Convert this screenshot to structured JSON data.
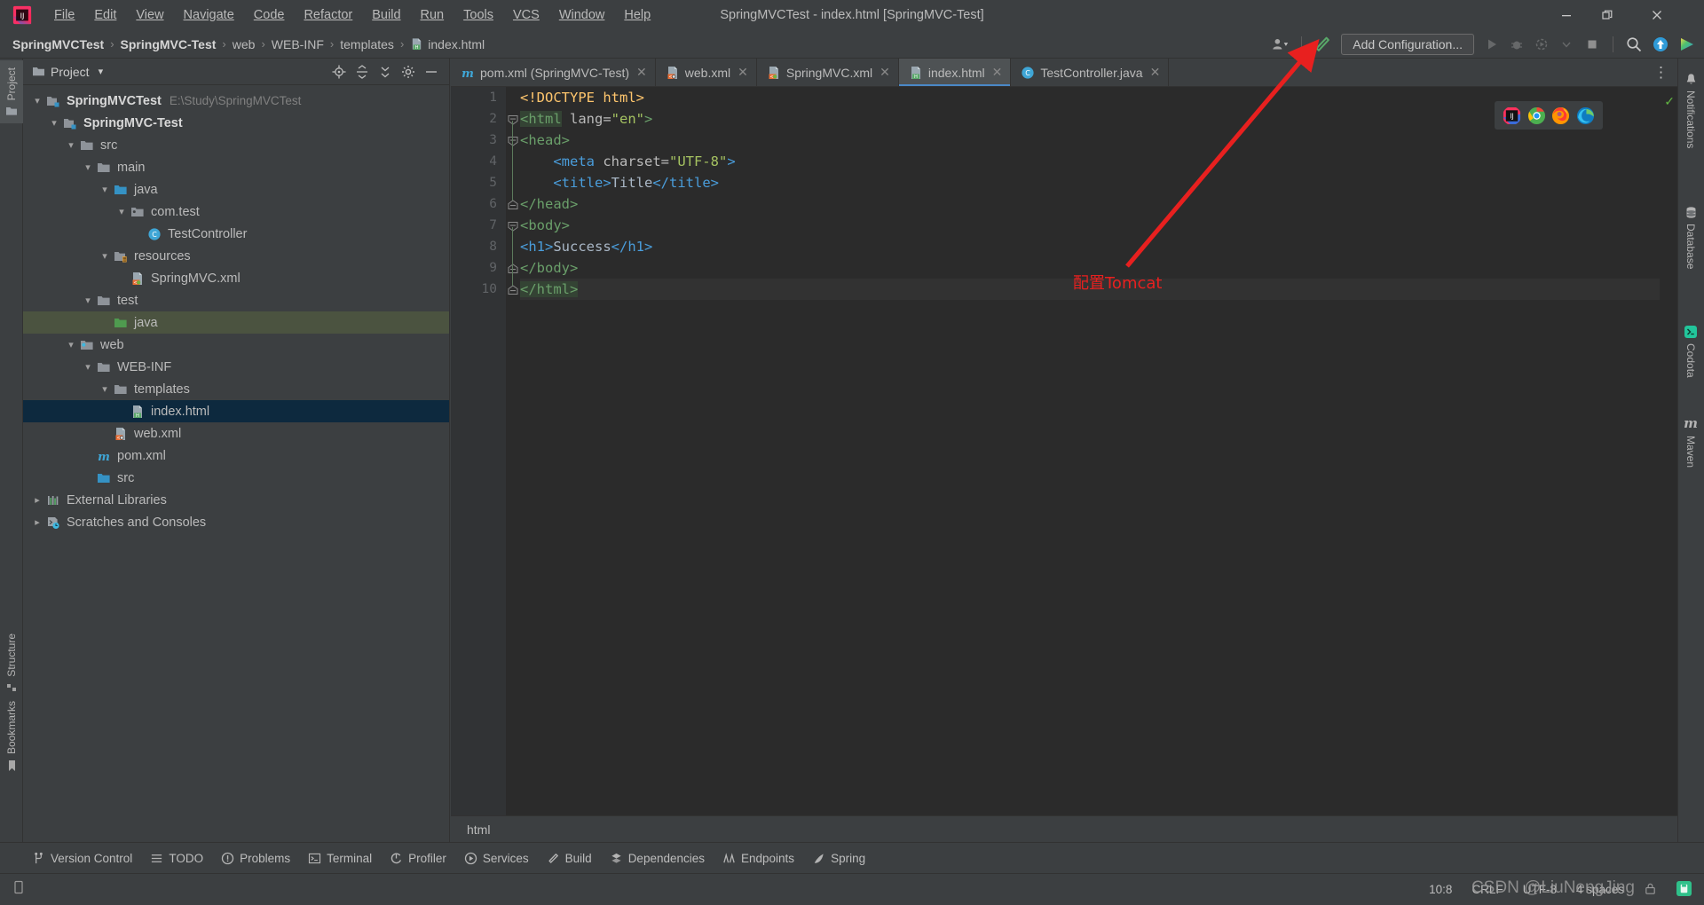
{
  "window": {
    "title": "SpringMVCTest - index.html [SpringMVC-Test]",
    "app_icon": "intellij-idea-logo",
    "minimize": "—",
    "restore": "❐",
    "close": "✕"
  },
  "menu": {
    "items": [
      {
        "label": "File",
        "mnemonic": "F"
      },
      {
        "label": "Edit",
        "mnemonic": "E"
      },
      {
        "label": "View",
        "mnemonic": "V"
      },
      {
        "label": "Navigate",
        "mnemonic": "N"
      },
      {
        "label": "Code",
        "mnemonic": "C"
      },
      {
        "label": "Refactor",
        "mnemonic": "R"
      },
      {
        "label": "Build",
        "mnemonic": "B"
      },
      {
        "label": "Run",
        "mnemonic": "R"
      },
      {
        "label": "Tools",
        "mnemonic": "T"
      },
      {
        "label": "VCS",
        "mnemonic": "S"
      },
      {
        "label": "Window",
        "mnemonic": "W"
      },
      {
        "label": "Help",
        "mnemonic": "H"
      }
    ]
  },
  "navbar": {
    "crumbs": [
      {
        "label": "SpringMVCTest",
        "bold": true,
        "icon": ""
      },
      {
        "label": "SpringMVC-Test",
        "bold": true,
        "icon": ""
      },
      {
        "label": "web",
        "bold": false,
        "icon": ""
      },
      {
        "label": "WEB-INF",
        "bold": false,
        "icon": ""
      },
      {
        "label": "templates",
        "bold": false,
        "icon": ""
      },
      {
        "label": "index.html",
        "bold": false,
        "icon": "html-file-icon"
      }
    ],
    "separator": "›",
    "add_configuration": "Add Configuration...",
    "icons": [
      "user-avatar-icon",
      "chevron-down-icon",
      "hammer-build-icon",
      "run-icon",
      "debug-icon",
      "run-coverage-icon",
      "run-dropdown-icon",
      "stop-icon",
      "search-icon",
      "update-project-icon",
      "idea-plugin-icon"
    ]
  },
  "left_tool_strip": {
    "top": [
      {
        "label": "Project",
        "icon": "folder-icon",
        "selected": true
      }
    ],
    "bottom": [
      {
        "label": "Structure",
        "icon": "structure-icon",
        "selected": false
      },
      {
        "label": "Bookmarks",
        "icon": "bookmark-icon",
        "selected": false
      }
    ]
  },
  "right_tool_strip": {
    "items": [
      {
        "label": "Notifications",
        "icon": "bell-icon"
      },
      {
        "label": "Database",
        "icon": "database-icon"
      },
      {
        "label": "Codota",
        "icon": "codota-icon"
      },
      {
        "label": "Maven",
        "icon": "maven-icon"
      }
    ]
  },
  "project_panel": {
    "title": "Project",
    "dropdown": "▾",
    "header_icons": [
      "locate-file-icon",
      "expand-all-icon",
      "collapse-all-icon",
      "gear-settings-icon",
      "hide-icon"
    ],
    "tree": [
      {
        "depth": 0,
        "arrow": "down",
        "icon": "module-folder-icon",
        "label": "SpringMVCTest",
        "bold": true,
        "path": "E:\\Study\\SpringMVCTest",
        "state": "none"
      },
      {
        "depth": 1,
        "arrow": "down",
        "icon": "module-folder-icon",
        "label": "SpringMVC-Test",
        "bold": true,
        "path": "",
        "state": "none"
      },
      {
        "depth": 2,
        "arrow": "down",
        "icon": "folder-icon",
        "label": "src",
        "bold": false,
        "path": "",
        "state": "none"
      },
      {
        "depth": 3,
        "arrow": "down",
        "icon": "folder-icon",
        "label": "main",
        "bold": false,
        "path": "",
        "state": "none"
      },
      {
        "depth": 4,
        "arrow": "down",
        "icon": "source-root-icon",
        "label": "java",
        "bold": false,
        "path": "",
        "state": "none"
      },
      {
        "depth": 5,
        "arrow": "down",
        "icon": "package-icon",
        "label": "com.test",
        "bold": false,
        "path": "",
        "state": "none"
      },
      {
        "depth": 6,
        "arrow": "none",
        "icon": "java-class-icon",
        "label": "TestController",
        "bold": false,
        "path": "",
        "state": "none"
      },
      {
        "depth": 4,
        "arrow": "down",
        "icon": "resources-root-icon",
        "label": "resources",
        "bold": false,
        "path": "",
        "state": "none"
      },
      {
        "depth": 5,
        "arrow": "none",
        "icon": "spring-xml-icon",
        "label": "SpringMVC.xml",
        "bold": false,
        "path": "",
        "state": "none"
      },
      {
        "depth": 3,
        "arrow": "down",
        "icon": "folder-icon",
        "label": "test",
        "bold": false,
        "path": "",
        "state": "none"
      },
      {
        "depth": 4,
        "arrow": "none",
        "icon": "test-root-icon",
        "label": "java",
        "bold": false,
        "path": "",
        "state": "selected-dir"
      },
      {
        "depth": 2,
        "arrow": "down",
        "icon": "web-root-icon",
        "label": "web",
        "bold": false,
        "path": "",
        "state": "none"
      },
      {
        "depth": 3,
        "arrow": "down",
        "icon": "folder-icon",
        "label": "WEB-INF",
        "bold": false,
        "path": "",
        "state": "none"
      },
      {
        "depth": 4,
        "arrow": "down",
        "icon": "folder-icon",
        "label": "templates",
        "bold": false,
        "path": "",
        "state": "none"
      },
      {
        "depth": 5,
        "arrow": "none",
        "icon": "html-file-icon",
        "label": "index.html",
        "bold": false,
        "path": "",
        "state": "selected-file"
      },
      {
        "depth": 4,
        "arrow": "none",
        "icon": "webxml-icon",
        "label": "web.xml",
        "bold": false,
        "path": "",
        "state": "none"
      },
      {
        "depth": 3,
        "arrow": "none",
        "icon": "maven-pom-icon",
        "label": "pom.xml",
        "bold": false,
        "path": "",
        "state": "none"
      },
      {
        "depth": 3,
        "arrow": "none",
        "icon": "source-root-icon",
        "label": "src",
        "bold": false,
        "path": "",
        "state": "none"
      },
      {
        "depth": 0,
        "arrow": "right",
        "icon": "libraries-icon",
        "label": "External Libraries",
        "bold": false,
        "path": "",
        "state": "none"
      },
      {
        "depth": 0,
        "arrow": "right",
        "icon": "scratches-icon",
        "label": "Scratches and Consoles",
        "bold": false,
        "path": "",
        "state": "none"
      }
    ]
  },
  "editor": {
    "tabs": [
      {
        "label": "pom.xml (SpringMVC-Test)",
        "icon": "maven-pom-icon",
        "active": false,
        "closable": true
      },
      {
        "label": "web.xml",
        "icon": "webxml-icon",
        "active": false,
        "closable": true
      },
      {
        "label": "SpringMVC.xml",
        "icon": "spring-xml-icon",
        "active": false,
        "closable": true
      },
      {
        "label": "index.html",
        "icon": "html-file-icon",
        "active": true,
        "closable": true
      },
      {
        "label": "TestController.java",
        "icon": "java-class-icon",
        "active": false,
        "closable": true
      }
    ],
    "more_icon": "more-vertical-icon",
    "lines": [
      {
        "n": 1,
        "fold": "none",
        "tokens": [
          {
            "t": "<!DOCTYPE ",
            "c": "tag"
          },
          {
            "t": "html>",
            "c": "tag"
          }
        ]
      },
      {
        "n": 2,
        "fold": "open",
        "tokens": [
          {
            "t": "<html",
            "c": "hl-ang"
          },
          {
            "t": " lang=",
            "c": "attr"
          },
          {
            "t": "\"en\"",
            "c": "str"
          },
          {
            "t": ">",
            "c": "ang"
          }
        ]
      },
      {
        "n": 3,
        "fold": "open",
        "tokens": [
          {
            "t": "<head>",
            "c": "ang"
          }
        ]
      },
      {
        "n": 4,
        "fold": "none",
        "tokens": [
          {
            "t": "    <meta ",
            "c": "tag2"
          },
          {
            "t": "charset=",
            "c": "attr"
          },
          {
            "t": "\"UTF-8\"",
            "c": "str"
          },
          {
            "t": ">",
            "c": "tag2"
          }
        ]
      },
      {
        "n": 5,
        "fold": "none",
        "tokens": [
          {
            "t": "    <title>",
            "c": "tag2"
          },
          {
            "t": "Title",
            "c": "txt"
          },
          {
            "t": "</title>",
            "c": "tag2"
          }
        ]
      },
      {
        "n": 6,
        "fold": "close",
        "tokens": [
          {
            "t": "</head>",
            "c": "ang"
          }
        ]
      },
      {
        "n": 7,
        "fold": "open",
        "tokens": [
          {
            "t": "<body>",
            "c": "ang"
          }
        ]
      },
      {
        "n": 8,
        "fold": "none",
        "tokens": [
          {
            "t": "<h1>",
            "c": "tag2"
          },
          {
            "t": "Success",
            "c": "txt"
          },
          {
            "t": "</h1>",
            "c": "tag2"
          }
        ]
      },
      {
        "n": 9,
        "fold": "close",
        "tokens": [
          {
            "t": "</body>",
            "c": "ang"
          }
        ]
      },
      {
        "n": 10,
        "fold": "close",
        "tokens": [
          {
            "t": "</html>",
            "c": "hl-ang"
          }
        ]
      }
    ],
    "breadcrumb_bottom": "html",
    "inspection_status": "ok-check",
    "browser_popup": [
      "intellij-browser-icon",
      "chrome-browser-icon",
      "firefox-browser-icon",
      "edge-browser-icon"
    ]
  },
  "tool_window_bar": {
    "items": [
      {
        "label": "Version Control",
        "icon": "branch-icon"
      },
      {
        "label": "TODO",
        "icon": "list-icon"
      },
      {
        "label": "Problems",
        "icon": "warning-icon"
      },
      {
        "label": "Terminal",
        "icon": "terminal-icon"
      },
      {
        "label": "Profiler",
        "icon": "profiler-icon"
      },
      {
        "label": "Services",
        "icon": "services-icon"
      },
      {
        "label": "Build",
        "icon": "hammer-icon"
      },
      {
        "label": "Dependencies",
        "icon": "dependencies-icon"
      },
      {
        "label": "Endpoints",
        "icon": "endpoints-icon"
      },
      {
        "label": "Spring",
        "icon": "spring-leaf-icon"
      }
    ]
  },
  "status_bar": {
    "left_icon": "event-log-icon",
    "caret_position": "10:8",
    "line_separator": "CRLF",
    "encoding": "UTF-8",
    "indent": "4 spaces",
    "lock_icon": "read-only-icon",
    "right_icon": "green-app-icon"
  },
  "annotation": {
    "text": "配置Tomcat",
    "color": "#e8201f",
    "arrow": "red-arrow-pointing-to-add-configuration"
  },
  "watermark": "CSDN @LiuNengJing"
}
